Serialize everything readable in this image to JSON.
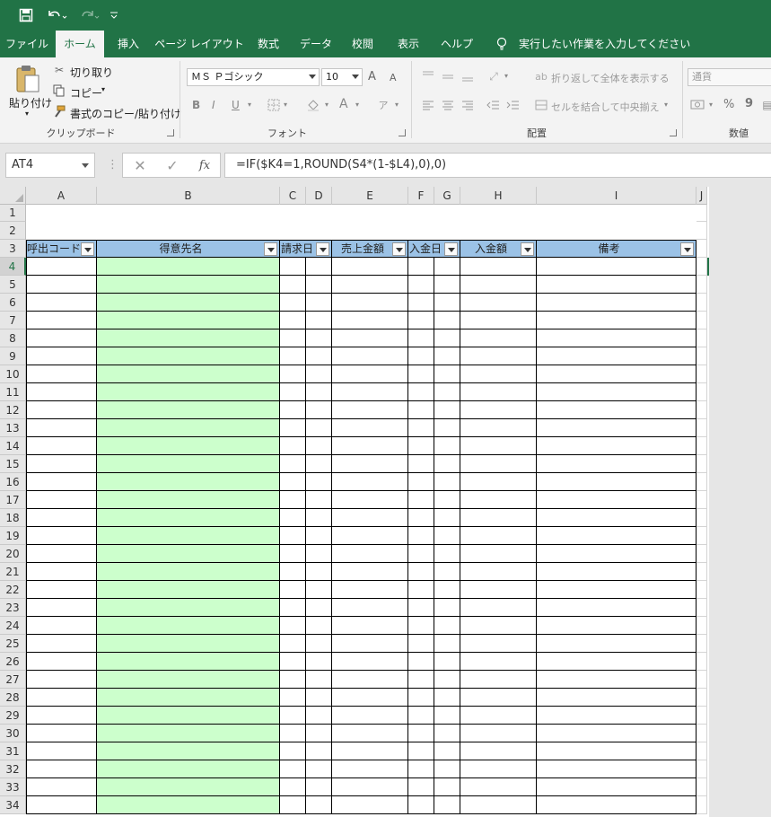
{
  "ribbon_tabs": [
    {
      "label": "ファイル",
      "active": false
    },
    {
      "label": "ホーム",
      "active": true
    },
    {
      "label": "挿入",
      "active": false
    },
    {
      "label": "ページ レイアウト",
      "active": false
    },
    {
      "label": "数式",
      "active": false
    },
    {
      "label": "データ",
      "active": false
    },
    {
      "label": "校閲",
      "active": false
    },
    {
      "label": "表示",
      "active": false
    },
    {
      "label": "ヘルプ",
      "active": false
    }
  ],
  "tell_me": "実行したい作業を入力してください",
  "clipboard": {
    "paste": "貼り付け",
    "cut": "切り取り",
    "copy": "コピー",
    "format_painter": "書式のコピー/貼り付け",
    "group": "クリップボード"
  },
  "font": {
    "name": "ＭＳ Ｐゴシック",
    "size": "10",
    "group": "フォント",
    "bold": "B",
    "italic": "I",
    "underline": "U",
    "grow": "A",
    "shrink": "A",
    "color": "A"
  },
  "alignment": {
    "wrap": "折り返して全体を表示する",
    "merge": "セルを結合して中央揃え",
    "group": "配置"
  },
  "number": {
    "format": "通貨",
    "percent": "%",
    "comma": "9",
    "group": "数値"
  },
  "formula_bar": {
    "name_box": "AT4",
    "fx": "fx",
    "formula": "=IF($K4=1,ROUND(S4*(1-$L4),0),0)"
  },
  "columns": [
    "A",
    "B",
    "C",
    "D",
    "E",
    "F",
    "G",
    "H",
    "I",
    "J"
  ],
  "rows": [
    "1",
    "2",
    "3",
    "4",
    "5",
    "6",
    "7",
    "8",
    "9",
    "10",
    "11",
    "12",
    "13",
    "14",
    "15",
    "16",
    "17",
    "18",
    "19",
    "20",
    "21",
    "22",
    "23",
    "24",
    "25",
    "26",
    "27",
    "28",
    "29",
    "30",
    "31",
    "32",
    "33",
    "34"
  ],
  "table_headers": [
    "呼出コード",
    "得意先名",
    "請求日",
    "売上金額",
    "入金日",
    "入金額",
    "備考"
  ],
  "colors": {
    "excel_green": "#217346",
    "header_blue": "#9bc2e6",
    "customer_green": "#ccffcc"
  }
}
